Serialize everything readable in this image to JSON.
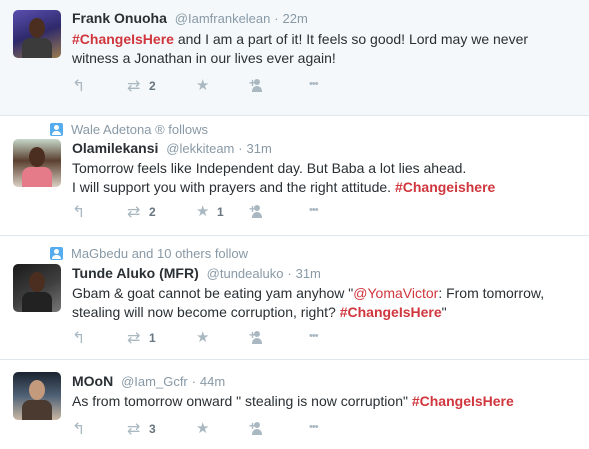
{
  "tweets": [
    {
      "context": "",
      "name": "Frank Onuoha",
      "handle": "@Iamfrankelean",
      "dot": "·",
      "time": "22m",
      "text_parts": [
        {
          "text": "#ChangeIsHere",
          "kind": "tag"
        },
        {
          "text": " and I am a part of it! It feels so good! Lord may we never witness a Jonathan in our lives ever again!",
          "kind": "plain"
        }
      ],
      "retweets": "2",
      "favorites": ""
    },
    {
      "context": "Wale Adetona ® follows",
      "name": "Olamilekansi",
      "handle": "@lekkiteam",
      "dot": "·",
      "time": "31m",
      "text_parts": [
        {
          "text": "Tomorrow feels like Independent day. But Baba a lot lies ahead.",
          "kind": "plain"
        },
        {
          "text": "\n",
          "kind": "br"
        },
        {
          "text": "I will support you with prayers and the right attitude. ",
          "kind": "plain"
        },
        {
          "text": "#Changeishere",
          "kind": "tag"
        }
      ],
      "retweets": "2",
      "favorites": "1"
    },
    {
      "context": "MaGbedu and 10 others follow",
      "name": "Tunde Aluko (MFR)",
      "handle": "@tundealuko",
      "dot": "·",
      "time": "31m",
      "text_parts": [
        {
          "text": "Gbam & goat cannot be eating yam anyhow \"",
          "kind": "plain"
        },
        {
          "text": "@YomaVictor",
          "kind": "mention"
        },
        {
          "text": ": From tomorrow, stealing will now become corruption, right? ",
          "kind": "plain"
        },
        {
          "text": "#ChangeIsHere",
          "kind": "tag"
        },
        {
          "text": "\"",
          "kind": "plain"
        }
      ],
      "retweets": "1",
      "favorites": ""
    },
    {
      "context": "",
      "name": "MOoN",
      "handle": "@Iam_Gcfr",
      "dot": "·",
      "time": "44m",
      "text_parts": [
        {
          "text": "As from tomorrow onward \" stealing is now corruption\" ",
          "kind": "plain"
        },
        {
          "text": "#ChangeIsHere",
          "kind": "tag"
        }
      ],
      "retweets": "3",
      "favorites": ""
    }
  ],
  "colors": {
    "hashtag": "#d0363d",
    "meta": "#8899a6",
    "context_icon": "#55acee",
    "highlight_bg": "#f5f8fa"
  },
  "icons": [
    "reply-icon",
    "retweet-icon",
    "favorite-icon",
    "follow-icon",
    "more-icon",
    "follow-context-icon"
  ]
}
